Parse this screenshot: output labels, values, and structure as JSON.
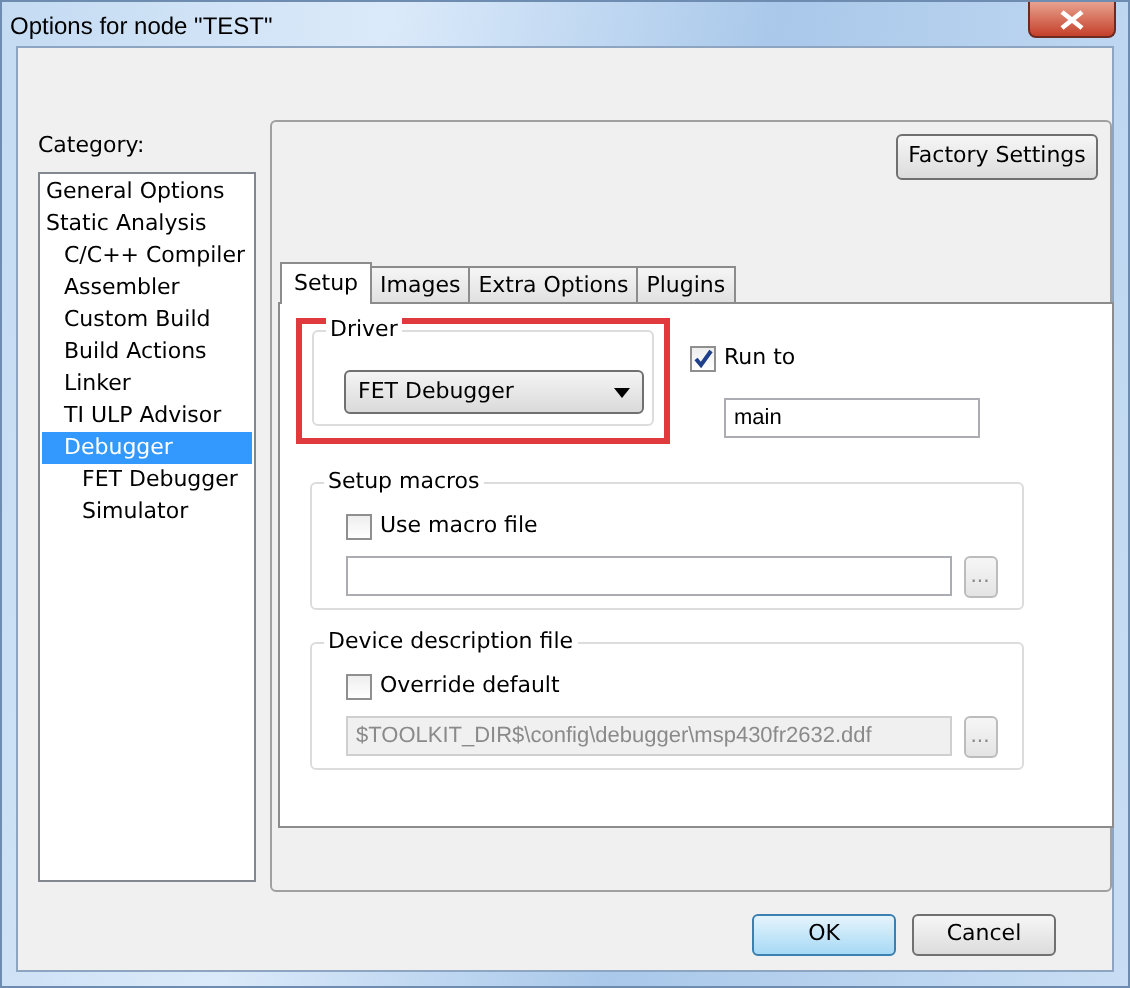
{
  "window": {
    "title": "Options for node \"TEST\""
  },
  "category": {
    "label": "Category:",
    "items": [
      {
        "label": "General Options",
        "selected": false
      },
      {
        "label": "Static Analysis",
        "selected": false,
        "children": [
          {
            "label": "C/C++ Compiler",
            "selected": false
          },
          {
            "label": "Assembler",
            "selected": false
          },
          {
            "label": "Custom Build",
            "selected": false
          },
          {
            "label": "Build Actions",
            "selected": false
          },
          {
            "label": "Linker",
            "selected": false
          },
          {
            "label": "TI ULP Advisor",
            "selected": false
          },
          {
            "label": "Debugger",
            "selected": true,
            "children": [
              {
                "label": "FET Debugger",
                "selected": false
              },
              {
                "label": "Simulator",
                "selected": false
              }
            ]
          }
        ]
      }
    ]
  },
  "factory_settings_button": "Factory Settings",
  "tabs": [
    {
      "label": "Setup",
      "selected": true
    },
    {
      "label": "Images",
      "selected": false
    },
    {
      "label": "Extra Options",
      "selected": false
    },
    {
      "label": "Plugins",
      "selected": false
    }
  ],
  "driver": {
    "title": "Driver",
    "value": "FET Debugger",
    "highlighted": true
  },
  "run_to": {
    "label": "Run to",
    "checked": true,
    "value": "main"
  },
  "setup_macros": {
    "title": "Setup macros",
    "checkbox": {
      "label": "Use macro file",
      "checked": false
    },
    "browse_button": "..."
  },
  "device_description": {
    "title": "Device description file",
    "checkbox": {
      "label": "Override default",
      "checked": false
    },
    "path": {
      "value": "$TOOLKIT_DIR$\\config\\debugger\\msp430fr2632.ddf",
      "disabled": true
    },
    "browse_button": "..."
  },
  "buttons": [
    {
      "label": "OK",
      "default": true
    },
    {
      "label": "Cancel",
      "default": false
    }
  ]
}
